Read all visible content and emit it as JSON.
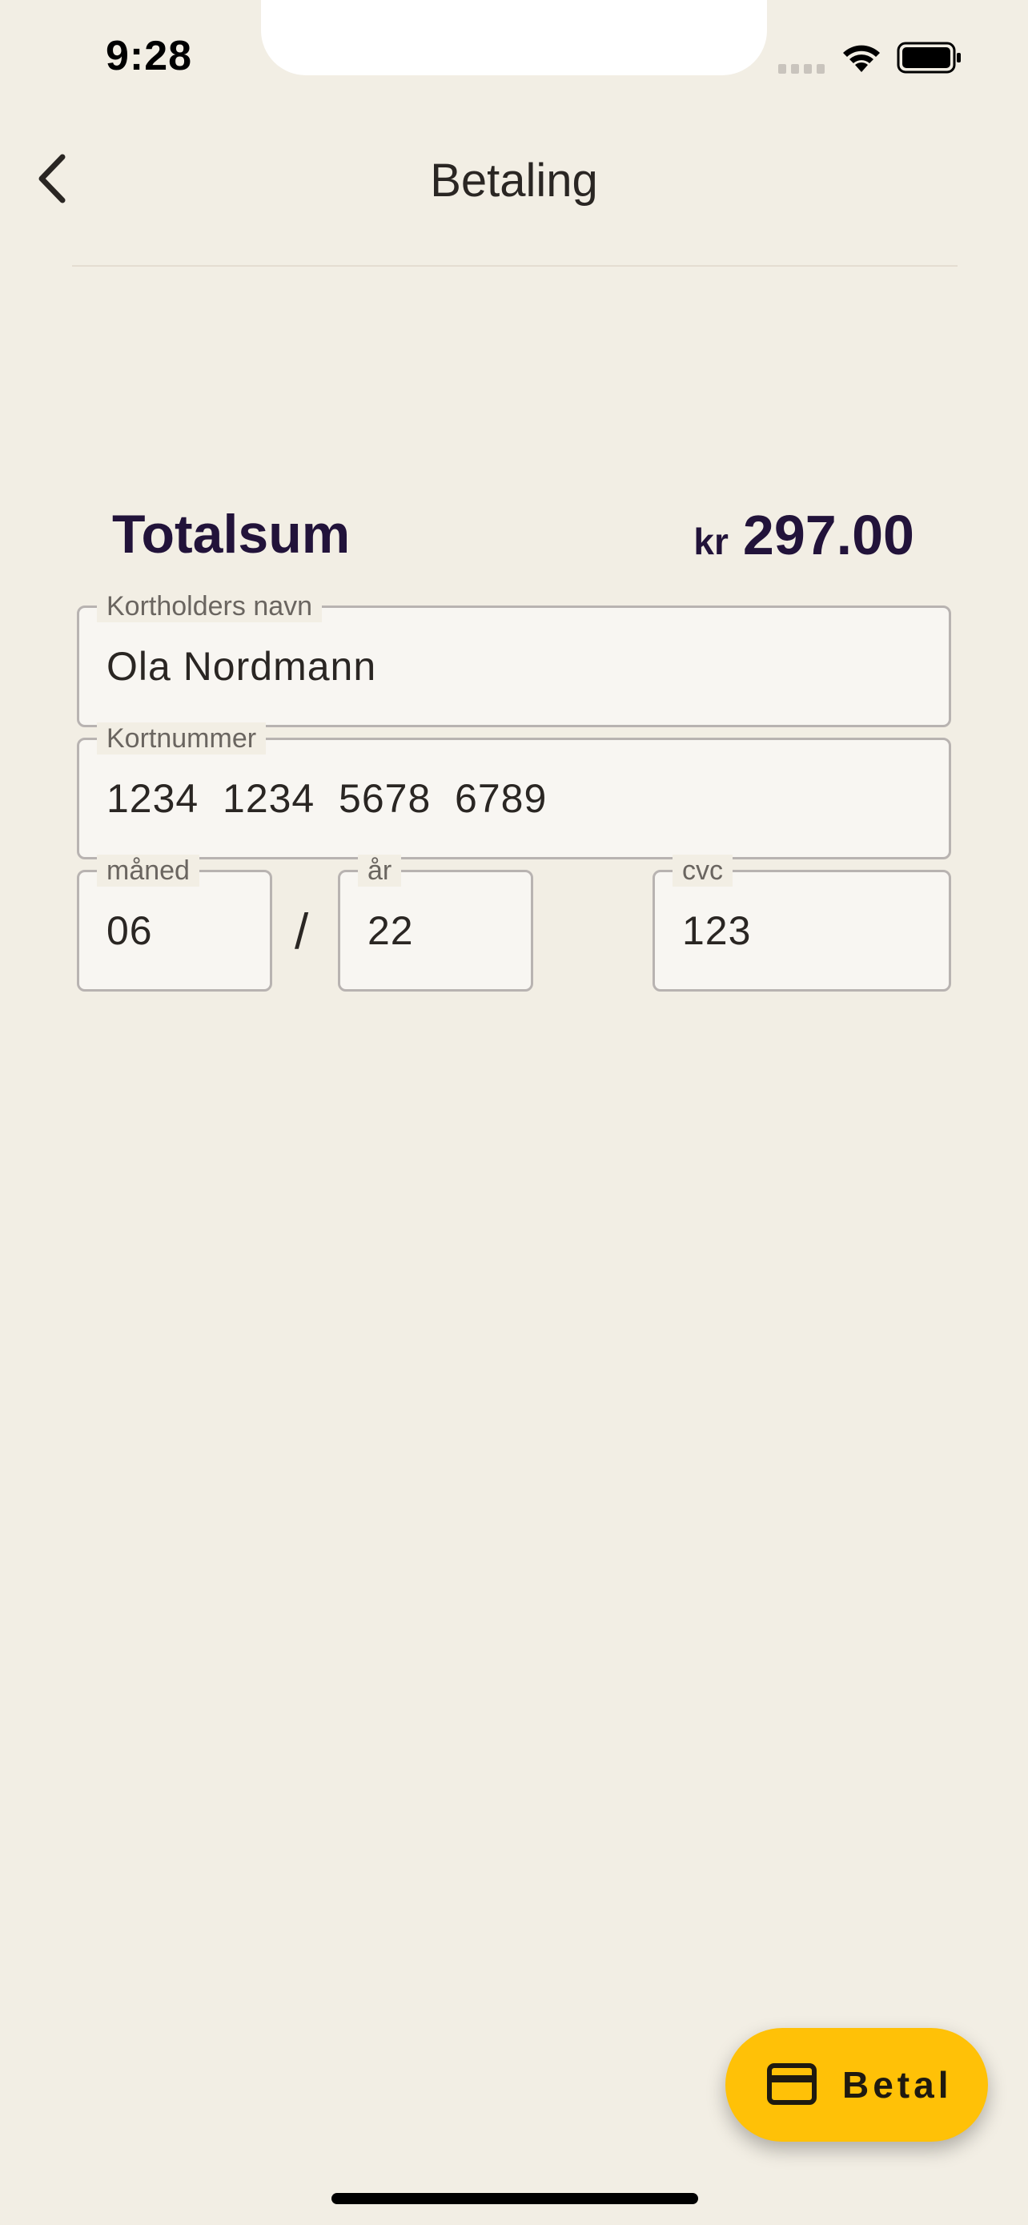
{
  "status_bar": {
    "time": "9:28"
  },
  "header": {
    "title": "Betaling",
    "back_icon": "chevron-left-icon"
  },
  "total": {
    "label": "Totalsum",
    "currency": "kr",
    "amount": "297.00"
  },
  "form": {
    "cardholder": {
      "label": "Kortholders navn",
      "value": "Ola Nordmann"
    },
    "card_number": {
      "label": "Kortnummer",
      "value": "1234  1234  5678  6789"
    },
    "month": {
      "label": "måned",
      "value": "06"
    },
    "separator": "/",
    "year": {
      "label": "år",
      "value": "22"
    },
    "cvc": {
      "label": "cvc",
      "value": "123"
    }
  },
  "pay_button": {
    "label": "Betal",
    "icon": "credit-card-icon",
    "color": "#ffc107"
  },
  "colors": {
    "background": "#f2eee4",
    "total_text": "#22133a",
    "field_border": "#b8b3b1"
  }
}
